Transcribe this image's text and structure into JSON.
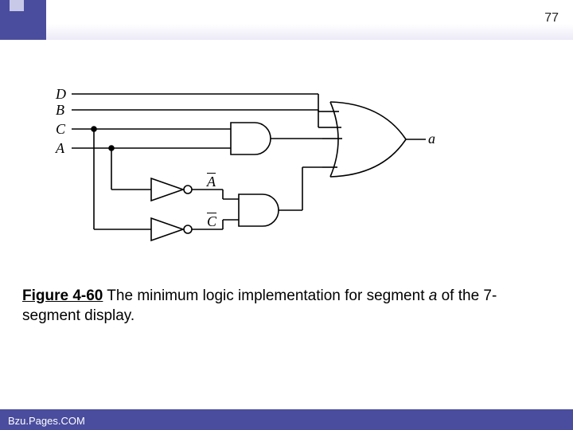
{
  "page_number": "77",
  "inputs": {
    "D": "D",
    "B": "B",
    "C": "C",
    "A": "A"
  },
  "not_labels": {
    "A_bar": "A",
    "C_bar": "C"
  },
  "output_label": "a",
  "caption": {
    "figure_label": "Figure 4-60",
    "text_before_italic": " The minimum logic implementation for segment ",
    "italic": "a",
    "text_after_italic": " of the 7-segment display."
  },
  "footer": "Bzu.Pages.COM",
  "gates": {
    "and1": "AND gate (C, A)",
    "and2": "AND gate (A̅, C̅)",
    "not1": "NOT gate (A)",
    "not2": "NOT gate (C)",
    "or": "OR gate (D, B, CA, A̅C̅)"
  }
}
